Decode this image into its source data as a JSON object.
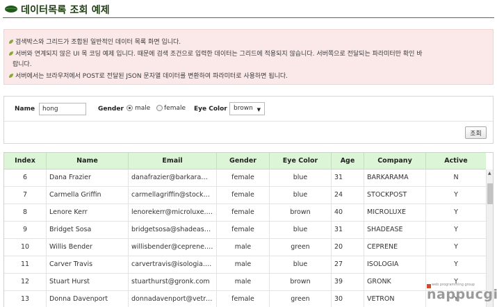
{
  "page": {
    "title": "데이터목록 조회 예제",
    "accent_color": "#2c8a2c",
    "leaf_icon": "leaf-icon"
  },
  "notice": {
    "bg_color": "#fbe9e9",
    "lines": [
      "검색박스와 그리드가 조합된 일반적인 데이터 목록 화면 입니다.",
      "서버와 연계되지 않은 UI 목 코딩 예제 입니다. 때문에 검색 조건으로 입력한 데이터는 그리드에 적용되지 않습니다. 서버쪽으로 전달되는 파라미터만 확인 바",
      "랍니다.",
      "서버에서는 브라우저에서 POST로 전달된 JSON 문자열 데이터를 변환하여 파라미터로 사용하면 됩니다."
    ]
  },
  "search": {
    "name_label": "Name",
    "name_value": "hong",
    "gender_label": "Gender",
    "gender_options": [
      "male",
      "female"
    ],
    "gender_selected": "male",
    "eye_label": "Eye Color",
    "eye_value": "brown",
    "search_button": "조회"
  },
  "grid": {
    "header_color": "#ddf5d7",
    "columns": [
      "Index",
      "Name",
      "Email",
      "Gender",
      "Eye Color",
      "Age",
      "Company",
      "Active"
    ],
    "rows": [
      [
        "6",
        "Dana Frazier",
        "danafrazier@barkarama...",
        "female",
        "blue",
        "31",
        "BARKARAMA",
        "N"
      ],
      [
        "7",
        "Carmella Griffin",
        "carmellagriffin@stockpo...",
        "female",
        "blue",
        "24",
        "STOCKPOST",
        "Y"
      ],
      [
        "8",
        "Lenore Kerr",
        "lenorekerr@microluxe.c...",
        "female",
        "brown",
        "40",
        "MICROLUXE",
        "Y"
      ],
      [
        "9",
        "Bridget Sosa",
        "bridgetsosa@shadease...",
        "female",
        "blue",
        "31",
        "SHADEASE",
        "Y"
      ],
      [
        "10",
        "Willis Bender",
        "willisbender@ceprene.c...",
        "male",
        "green",
        "20",
        "CEPRENE",
        "Y"
      ],
      [
        "11",
        "Carver Travis",
        "carvertravis@isologia.co...",
        "male",
        "blue",
        "27",
        "ISOLOGIA",
        "Y"
      ],
      [
        "12",
        "Stuart Hurst",
        "stuarthurst@gronk.com",
        "male",
        "brown",
        "39",
        "GRONK",
        "Y"
      ],
      [
        "13",
        "Donna Davenport",
        "donnadavenport@vetro...",
        "female",
        "green",
        "30",
        "VETRON",
        "Y"
      ]
    ]
  },
  "watermark": {
    "tagline": "web programming group",
    "text": "nappucgi"
  }
}
